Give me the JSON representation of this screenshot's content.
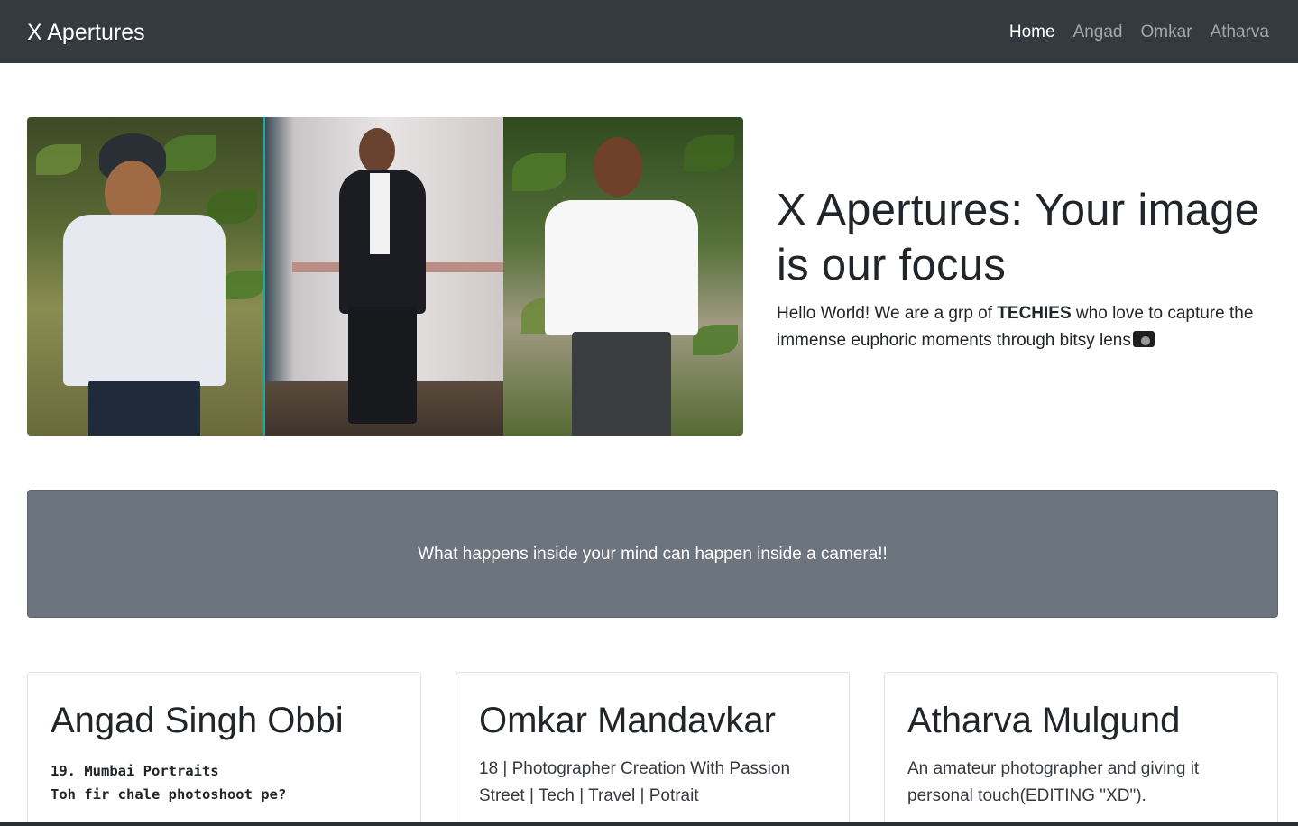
{
  "navbar": {
    "brand": "X Apertures",
    "links": [
      {
        "label": "Home",
        "active": true
      },
      {
        "label": "Angad",
        "active": false
      },
      {
        "label": "Omkar",
        "active": false
      },
      {
        "label": "Atharva",
        "active": false
      }
    ]
  },
  "hero": {
    "title": "X Apertures: Your image is our focus",
    "text_before": "Hello World! We are a grp of ",
    "text_bold": "TECHIES",
    "text_after": " who love to capture the immense euphoric moments through bitsy lens",
    "icon": "camera-icon"
  },
  "band": {
    "text": "What happens inside your mind can happen inside a camera!!"
  },
  "cards": [
    {
      "title": "Angad Singh Obbi",
      "lines": [
        "19. Mumbai Portraits",
        "Toh fir chale photoshoot pe?"
      ]
    },
    {
      "title": "Omkar Mandavkar",
      "lines": [
        "18 | Photographer Creation With Passion",
        "Street | Tech | Travel | Potrait"
      ]
    },
    {
      "title": "Atharva Mulgund",
      "lines": [
        "An amateur photographer and giving it personal touch(EDITING \"XD\")."
      ]
    }
  ],
  "colors": {
    "navbar_bg": "#343a40",
    "band_bg": "#6c757d",
    "text": "#212529"
  }
}
